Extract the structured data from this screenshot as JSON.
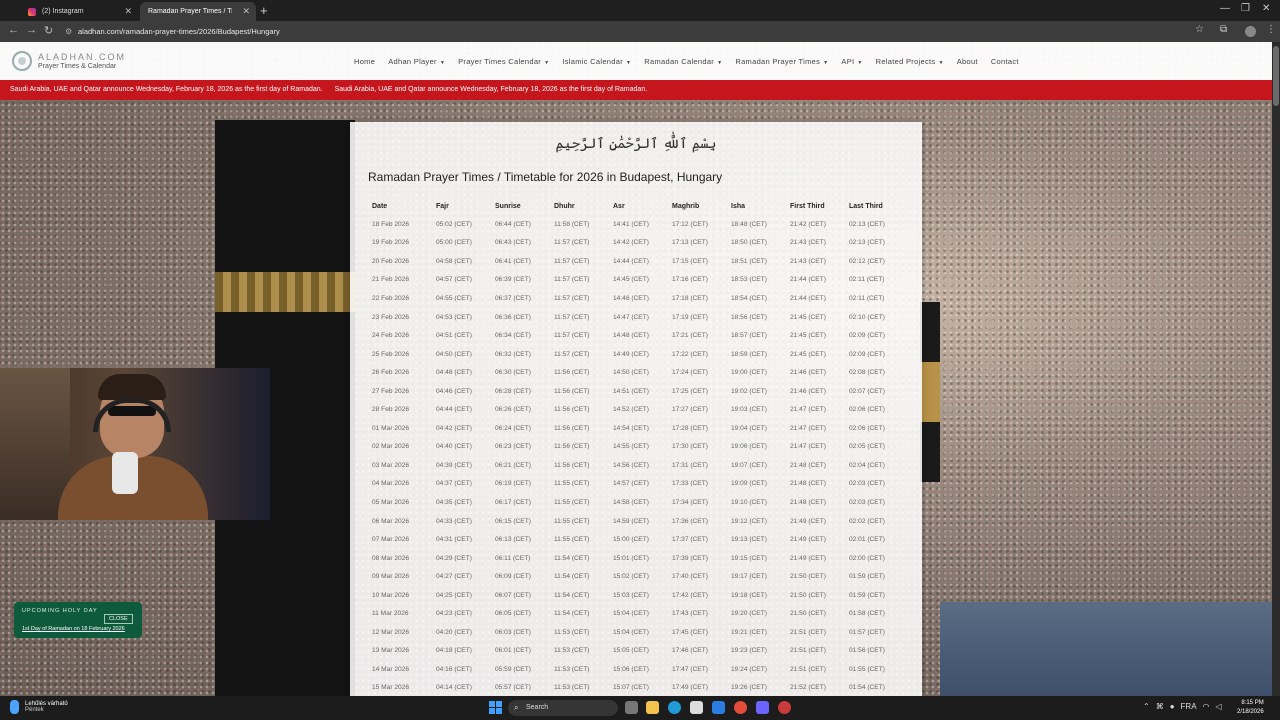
{
  "browser": {
    "tabs": [
      {
        "title": "(2) Instagram",
        "active": false
      },
      {
        "title": "Ramadan Prayer Times / Timetab",
        "active": true
      }
    ],
    "url": "aladhan.com/ramadan-prayer-times/2026/Budapest/Hungary"
  },
  "site": {
    "logo_title": "ALADHAN.COM",
    "logo_subtitle": "Prayer Times & Calendar",
    "menu": [
      {
        "label": "Home",
        "dropdown": false
      },
      {
        "label": "Adhan Player",
        "dropdown": true
      },
      {
        "label": "Prayer Times Calendar",
        "dropdown": true
      },
      {
        "label": "Islamic Calendar",
        "dropdown": true
      },
      {
        "label": "Ramadan Calendar",
        "dropdown": true
      },
      {
        "label": "Ramadan Prayer Times",
        "dropdown": true
      },
      {
        "label": "API",
        "dropdown": true
      },
      {
        "label": "Related Projects",
        "dropdown": true
      },
      {
        "label": "About",
        "dropdown": false
      },
      {
        "label": "Contact",
        "dropdown": false
      }
    ],
    "announcement": "Saudi Arabia, UAE and Qatar announce Wednesday, February 18, 2026 as the first day of Ramadan.",
    "bismillah": "بِسْمِ ٱللَّٰهِ ٱلرَّحْمَٰنِ ٱلرَّحِيمِ",
    "title": "Ramadan Prayer Times / Timetable for 2026 in Budapest, Hungary",
    "table": {
      "headers": [
        "Date",
        "Fajr",
        "Sunrise",
        "Dhuhr",
        "Asr",
        "Maghrib",
        "Isha",
        "First Third",
        "Last Third"
      ],
      "rows": [
        [
          "18 Feb 2026",
          "05:02 (CET)",
          "06:44 (CET)",
          "11:58 (CET)",
          "14:41 (CET)",
          "17:12 (CET)",
          "18:48 (CET)",
          "21:42 (CET)",
          "02:13 (CET)"
        ],
        [
          "19 Feb 2026",
          "05:00 (CET)",
          "06:43 (CET)",
          "11:57 (CET)",
          "14:42 (CET)",
          "17:13 (CET)",
          "18:50 (CET)",
          "21:43 (CET)",
          "02:13 (CET)"
        ],
        [
          "20 Feb 2026",
          "04:58 (CET)",
          "06:41 (CET)",
          "11:57 (CET)",
          "14:44 (CET)",
          "17:15 (CET)",
          "18:51 (CET)",
          "21:43 (CET)",
          "02:12 (CET)"
        ],
        [
          "21 Feb 2026",
          "04:57 (CET)",
          "06:39 (CET)",
          "11:57 (CET)",
          "14:45 (CET)",
          "17:16 (CET)",
          "18:53 (CET)",
          "21:44 (CET)",
          "02:11 (CET)"
        ],
        [
          "22 Feb 2026",
          "04:55 (CET)",
          "06:37 (CET)",
          "11:57 (CET)",
          "14:46 (CET)",
          "17:18 (CET)",
          "18:54 (CET)",
          "21:44 (CET)",
          "02:11 (CET)"
        ],
        [
          "23 Feb 2026",
          "04:53 (CET)",
          "06:36 (CET)",
          "11:57 (CET)",
          "14:47 (CET)",
          "17:19 (CET)",
          "18:56 (CET)",
          "21:45 (CET)",
          "02:10 (CET)"
        ],
        [
          "24 Feb 2026",
          "04:51 (CET)",
          "06:34 (CET)",
          "11:57 (CET)",
          "14:48 (CET)",
          "17:21 (CET)",
          "18:57 (CET)",
          "21:45 (CET)",
          "02:09 (CET)"
        ],
        [
          "25 Feb 2026",
          "04:50 (CET)",
          "06:32 (CET)",
          "11:57 (CET)",
          "14:49 (CET)",
          "17:22 (CET)",
          "18:59 (CET)",
          "21:45 (CET)",
          "02:09 (CET)"
        ],
        [
          "26 Feb 2026",
          "04:48 (CET)",
          "06:30 (CET)",
          "11:56 (CET)",
          "14:50 (CET)",
          "17:24 (CET)",
          "19:00 (CET)",
          "21:46 (CET)",
          "02:08 (CET)"
        ],
        [
          "27 Feb 2026",
          "04:46 (CET)",
          "06:28 (CET)",
          "11:56 (CET)",
          "14:51 (CET)",
          "17:25 (CET)",
          "19:02 (CET)",
          "21:46 (CET)",
          "02:07 (CET)"
        ],
        [
          "28 Feb 2026",
          "04:44 (CET)",
          "06:26 (CET)",
          "11:56 (CET)",
          "14:52 (CET)",
          "17:27 (CET)",
          "19:03 (CET)",
          "21:47 (CET)",
          "02:06 (CET)"
        ],
        [
          "01 Mar 2026",
          "04:42 (CET)",
          "06:24 (CET)",
          "11:56 (CET)",
          "14:54 (CET)",
          "17:28 (CET)",
          "19:04 (CET)",
          "21:47 (CET)",
          "02:06 (CET)"
        ],
        [
          "02 Mar 2026",
          "04:40 (CET)",
          "06:23 (CET)",
          "11:56 (CET)",
          "14:55 (CET)",
          "17:30 (CET)",
          "19:06 (CET)",
          "21:47 (CET)",
          "02:05 (CET)"
        ],
        [
          "03 Mar 2026",
          "04:39 (CET)",
          "06:21 (CET)",
          "11:56 (CET)",
          "14:56 (CET)",
          "17:31 (CET)",
          "19:07 (CET)",
          "21:48 (CET)",
          "02:04 (CET)"
        ],
        [
          "04 Mar 2026",
          "04:37 (CET)",
          "06:19 (CET)",
          "11:55 (CET)",
          "14:57 (CET)",
          "17:33 (CET)",
          "19:09 (CET)",
          "21:48 (CET)",
          "02:03 (CET)"
        ],
        [
          "05 Mar 2026",
          "04:35 (CET)",
          "06:17 (CET)",
          "11:55 (CET)",
          "14:58 (CET)",
          "17:34 (CET)",
          "19:10 (CET)",
          "21:48 (CET)",
          "02:03 (CET)"
        ],
        [
          "06 Mar 2026",
          "04:33 (CET)",
          "06:15 (CET)",
          "11:55 (CET)",
          "14:59 (CET)",
          "17:36 (CET)",
          "19:12 (CET)",
          "21:49 (CET)",
          "02:02 (CET)"
        ],
        [
          "07 Mar 2026",
          "04:31 (CET)",
          "06:13 (CET)",
          "11:55 (CET)",
          "15:00 (CET)",
          "17:37 (CET)",
          "19:13 (CET)",
          "21:49 (CET)",
          "02:01 (CET)"
        ],
        [
          "08 Mar 2026",
          "04:29 (CET)",
          "06:11 (CET)",
          "11:54 (CET)",
          "15:01 (CET)",
          "17:39 (CET)",
          "19:15 (CET)",
          "21:49 (CET)",
          "02:00 (CET)"
        ],
        [
          "09 Mar 2026",
          "04:27 (CET)",
          "06:09 (CET)",
          "11:54 (CET)",
          "15:02 (CET)",
          "17:40 (CET)",
          "19:17 (CET)",
          "21:50 (CET)",
          "01:59 (CET)"
        ],
        [
          "10 Mar 2026",
          "04:25 (CET)",
          "06:07 (CET)",
          "11:54 (CET)",
          "15:03 (CET)",
          "17:42 (CET)",
          "19:18 (CET)",
          "21:50 (CET)",
          "01:59 (CET)"
        ],
        [
          "11 Mar 2026",
          "04:23 (CET)",
          "06:05 (CET)",
          "11:54 (CET)",
          "15:04 (CET)",
          "17:43 (CET)",
          "19:20 (CET)",
          "21:50 (CET)",
          "01:58 (CET)"
        ],
        [
          "12 Mar 2026",
          "04:20 (CET)",
          "06:03 (CET)",
          "11:53 (CET)",
          "15:04 (CET)",
          "17:45 (CET)",
          "19:21 (CET)",
          "21:51 (CET)",
          "01:57 (CET)"
        ],
        [
          "13 Mar 2026",
          "04:18 (CET)",
          "06:01 (CET)",
          "11:53 (CET)",
          "15:05 (CET)",
          "17:46 (CET)",
          "19:23 (CET)",
          "21:51 (CET)",
          "01:56 (CET)"
        ],
        [
          "14 Mar 2026",
          "04:16 (CET)",
          "05:59 (CET)",
          "11:53 (CET)",
          "15:06 (CET)",
          "17:47 (CET)",
          "19:24 (CET)",
          "21:51 (CET)",
          "01:55 (CET)"
        ],
        [
          "15 Mar 2026",
          "04:14 (CET)",
          "05:57 (CET)",
          "11:53 (CET)",
          "15:07 (CET)",
          "17:49 (CET)",
          "19:26 (CET)",
          "21:52 (CET)",
          "01:54 (CET)"
        ]
      ]
    },
    "holy_day": {
      "label": "UPCOMING HOLY DAY",
      "close": "CLOSE",
      "link": "1st Day of Ramadan on 18 February 2026"
    }
  },
  "taskbar": {
    "weather_line1": "Lehűlés várható",
    "weather_line2": "Péntek",
    "search_placeholder": "Search",
    "language": "FRA",
    "time": "8:15 PM",
    "date": "2/18/2026"
  },
  "colors": {
    "announcement_bg": "#c4161c",
    "holy_day_bg": "#0e5a3c",
    "taskbar_bg": "#1c1c1c"
  }
}
